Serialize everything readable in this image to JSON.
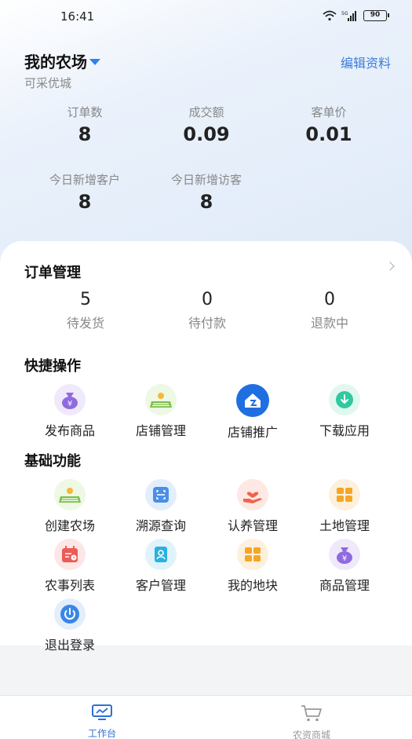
{
  "status_bar": {
    "time": "16:41",
    "network": "5G",
    "battery": "90"
  },
  "header": {
    "farm_name": "我的农场",
    "edit_label": "编辑资料",
    "subtitle": "可采优城"
  },
  "stats": [
    {
      "label": "订单数",
      "value": "8"
    },
    {
      "label": "成交额",
      "value": "0.09"
    },
    {
      "label": "客单价",
      "value": "0.01"
    },
    {
      "label": "今日新增客户",
      "value": "8"
    },
    {
      "label": "今日新增访客",
      "value": "8"
    }
  ],
  "orders": {
    "title": "订单管理",
    "items": [
      {
        "count": "5",
        "label": "待发货"
      },
      {
        "count": "0",
        "label": "待付款"
      },
      {
        "count": "0",
        "label": "退款中"
      }
    ]
  },
  "quick": {
    "title": "快捷操作",
    "items": [
      {
        "label": "发布商品",
        "icon": "money-bag-icon"
      },
      {
        "label": "店铺管理",
        "icon": "farm-field-icon"
      },
      {
        "label": "店铺推广",
        "icon": "house-badge-icon"
      },
      {
        "label": "下载应用",
        "icon": "download-icon"
      }
    ]
  },
  "basic": {
    "title": "基础功能",
    "items": [
      {
        "label": "创建农场",
        "icon": "farm-field-icon"
      },
      {
        "label": "溯源查询",
        "icon": "scan-icon"
      },
      {
        "label": "认养管理",
        "icon": "hand-heart-icon"
      },
      {
        "label": "土地管理",
        "icon": "land-grid-icon"
      },
      {
        "label": "农事列表",
        "icon": "calendar-icon"
      },
      {
        "label": "客户管理",
        "icon": "id-card-icon"
      },
      {
        "label": "我的地块",
        "icon": "plot-grid-icon"
      },
      {
        "label": "商品管理",
        "icon": "money-bag-icon"
      },
      {
        "label": "退出登录",
        "icon": "power-icon"
      }
    ]
  },
  "nav": {
    "items": [
      {
        "label": "工作台",
        "icon": "monitor-icon",
        "active": true
      },
      {
        "label": "农资商城",
        "icon": "cart-icon",
        "active": false
      }
    ]
  },
  "colors": {
    "accent": "#2f80ed",
    "link": "#3b7dd8",
    "active_nav": "#2f6fd6",
    "inactive_nav": "#999999"
  }
}
